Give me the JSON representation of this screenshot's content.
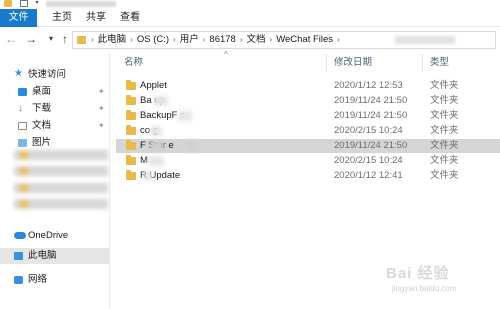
{
  "ribbon": {
    "tabs": [
      "文件",
      "主页",
      "共享",
      "查看"
    ]
  },
  "address": {
    "crumbs": [
      "此电脑",
      "OS (C:)",
      "用户",
      "86178",
      "文档",
      "WeChat Files"
    ]
  },
  "nav": {
    "quick_access": "快速访问",
    "items": [
      {
        "label": "桌面",
        "icon": "desktop-icon"
      },
      {
        "label": "下载",
        "icon": "download-icon"
      },
      {
        "label": "文档",
        "icon": "document-icon"
      },
      {
        "label": "图片",
        "icon": "picture-icon"
      }
    ],
    "onedrive": "OneDrive",
    "this_pc": "此电脑",
    "network": "网络"
  },
  "columns": {
    "name": "名称",
    "date": "修改日期",
    "type": "类型"
  },
  "files": [
    {
      "name": "Applet",
      "date": "2020/1/12 12:53",
      "type": "文件夹",
      "selected": false
    },
    {
      "name": "Ba  up",
      "date": "2019/11/24 21:50",
      "type": "文件夹",
      "selected": false
    },
    {
      "name": "BackupF  s",
      "date": "2019/11/24 21:50",
      "type": "文件夹",
      "selected": false
    },
    {
      "name": "co  g",
      "date": "2020/2/15 10:24",
      "type": "文件夹",
      "selected": false
    },
    {
      "name": "F  Stor  e",
      "date": "2019/11/24 21:50",
      "type": "文件夹",
      "selected": true
    },
    {
      "name": "M",
      "date": "2020/2/15 10:24",
      "type": "文件夹",
      "selected": false
    },
    {
      "name": "R  Update",
      "date": "2020/1/12 12:41",
      "type": "文件夹",
      "selected": false
    }
  ],
  "watermark": {
    "logo": "Bai 经验",
    "sub": "jingyan.baidu.com"
  }
}
